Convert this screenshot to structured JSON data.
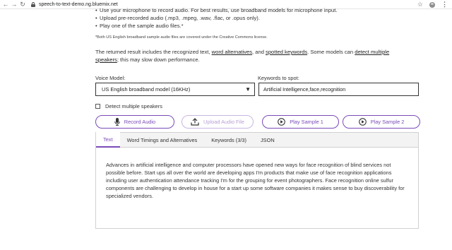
{
  "browser": {
    "url": "speech-to-text-demo.ng.bluemix.net"
  },
  "intro": {
    "bullets": [
      "Use your microphone to record audio. For best results, use broadband models for microphone input.",
      "Upload pre-recorded audio (.mp3, .mpeg, .wav, .flac, or .opus only).",
      "Play one of the sample audio files.*"
    ],
    "footnote": "*Both US English broadband sample audio files are covered under the Creative Commons license.",
    "desc_part1": "The returned result includes the recognized text, ",
    "desc_link1": "word alternatives",
    "desc_part2": ", and ",
    "desc_link2": "spotted keywords",
    "desc_part3": ". Some models can ",
    "desc_link3": "detect multiple speakers",
    "desc_part4": "; this may slow down performance."
  },
  "form": {
    "voice_model_label": "Voice Model:",
    "voice_model_value": "US English broadband model (16KHz)",
    "keywords_label": "Keywords to spot:",
    "keywords_value": "Artificial Intelligence,face,recognition",
    "detect_speakers_label": "Detect multiple speakers"
  },
  "buttons": {
    "record": "Record Audio",
    "upload": "Upload Audio File",
    "sample1": "Play Sample 1",
    "sample2": "Play Sample 2"
  },
  "tabs": [
    "Text",
    "Word Timings and Alternatives",
    "Keywords (3/3)",
    "JSON"
  ],
  "output": {
    "text": "Advances in artificial intelligence and computer processors have opened new ways for face recognition of blind services not possible before. Start ups all over the world are developing apps I'm products that make use of face recognition applications including user authentication attendance tracking I'm for the grouping for event photographers. Face recognition online sulfur components are challenging to develop in house for a start up some software companies it makes sense to buy discoverability for specialized vendors."
  },
  "colors": {
    "accent": "#7a4ab8",
    "accent_disabled": "#b89fd6"
  },
  "icons": {
    "record": "microphone-icon",
    "upload": "upload-icon",
    "play": "play-circle-icon"
  }
}
